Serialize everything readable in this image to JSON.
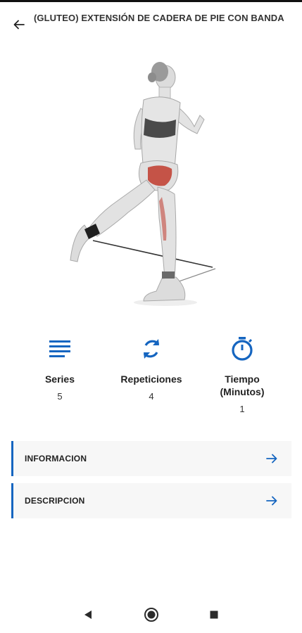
{
  "header": {
    "title": "(GLUTEO) EXTENSIÓN DE CADERA DE PIE CON BANDA",
    "back_icon": "arrow-left-icon"
  },
  "stats": [
    {
      "label": "Series",
      "value": "5",
      "icon": "list-lines-icon"
    },
    {
      "label": "Repeticiones",
      "value": "4",
      "icon": "repeat-icon"
    },
    {
      "label": "Tiempo\n(Minutos)",
      "value": "1",
      "icon": "stopwatch-icon"
    }
  ],
  "rows": [
    {
      "label": "INFORMACION",
      "icon": "arrow-right-icon"
    },
    {
      "label": "DESCRIPCION",
      "icon": "arrow-right-icon"
    }
  ],
  "colors": {
    "accent": "#1565c0",
    "row_background": "#f7f7f7",
    "muscle_highlight": "#c0392b"
  },
  "navbar": {
    "back": "nav-back-icon",
    "home": "nav-home-icon",
    "recents": "nav-recents-icon"
  }
}
